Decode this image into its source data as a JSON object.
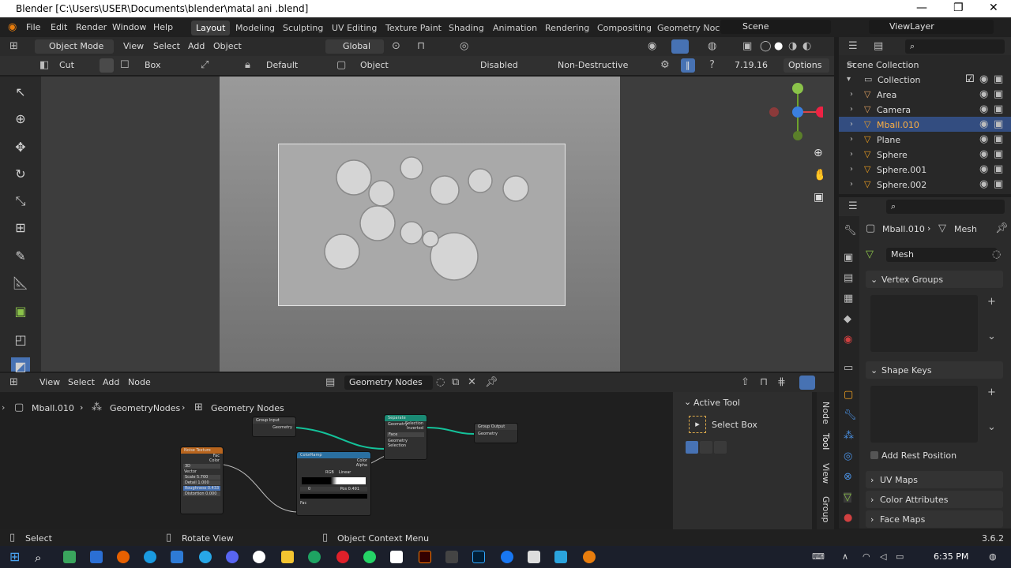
{
  "window": {
    "title": "Blender [C:\\Users\\USER\\Documents\\blender\\matal ani .blend]",
    "minimize": "—",
    "maximize": "❐",
    "close": "✕"
  },
  "menu": [
    "File",
    "Edit",
    "Render",
    "Window",
    "Help"
  ],
  "workspaces": [
    "Layout",
    "Modeling",
    "Sculpting",
    "UV Editing",
    "Texture Paint",
    "Shading",
    "Animation",
    "Rendering",
    "Compositing",
    "Geometry Noc"
  ],
  "scene": "Scene",
  "view_layer": "ViewLayer",
  "viewport_header": {
    "mode": "Object Mode",
    "view": "View",
    "select": "Select",
    "add": "Add",
    "object": "Object",
    "orientation": "Global"
  },
  "tool_header": {
    "cut": "Cut",
    "box": "Box",
    "default": "Default",
    "object": "Object",
    "disabled": "Disabled",
    "non_destructive": "Non-Destructive",
    "version": "7.19.16",
    "options": "Options"
  },
  "outliner": {
    "root": "Scene Collection",
    "collection": "Collection",
    "items": [
      {
        "name": "Area",
        "color": "#e0a060"
      },
      {
        "name": "Camera",
        "color": "#e0a060"
      },
      {
        "name": "Mball.010",
        "color": "#f0a020"
      },
      {
        "name": "Plane",
        "color": "#f0a020"
      },
      {
        "name": "Sphere",
        "color": "#f0a020"
      },
      {
        "name": "Sphere.001",
        "color": "#f0a020"
      },
      {
        "name": "Sphere.002",
        "color": "#f0a020"
      }
    ]
  },
  "properties": {
    "breadcrumb_obj": "Mball.010",
    "breadcrumb_data": "Mesh",
    "mesh_name": "Mesh",
    "panels": [
      "Vertex Groups",
      "Shape Keys",
      "UV Maps",
      "Color Attributes",
      "Face Maps"
    ],
    "add_rest_position": "Add Rest Position"
  },
  "node_editor": {
    "menus": [
      "View",
      "Select",
      "Add",
      "Node"
    ],
    "tree_name": "Geometry Nodes",
    "breadcrumb": [
      "Mball.010",
      "GeometryNodes",
      "Geometry Nodes"
    ],
    "nodes": {
      "group_input": {
        "title": "Group Input",
        "out": "Geometry"
      },
      "separate": {
        "title": "Separate Geometry",
        "rows": [
          "Selection",
          "Inverted",
          "Face",
          "Geometry",
          "Selection"
        ]
      },
      "group_output": {
        "title": "Group Output",
        "in": "Geometry"
      },
      "noise": {
        "title": "Noise Texture",
        "rows": [
          "Fac",
          "Color",
          "3D",
          "Vector",
          "Scale 5.700",
          "Detail 1.000",
          "Roughness 0.433",
          "Distortion 0.000"
        ]
      },
      "ramp": {
        "title": "ColorRamp",
        "rows": [
          "Color",
          "Alpha",
          "RGB",
          "Linear",
          "0",
          "Pos 0.491",
          "Fac"
        ]
      }
    }
  },
  "n_panel": {
    "section": "Active Tool",
    "tool": "Select Box",
    "tabs": [
      "Node",
      "Tool",
      "View",
      "Group"
    ]
  },
  "status": {
    "left": "Select",
    "middle": "Rotate View",
    "right": "Object Context Menu",
    "version": "3.6.2"
  },
  "taskbar": {
    "time": "6:35 PM"
  }
}
